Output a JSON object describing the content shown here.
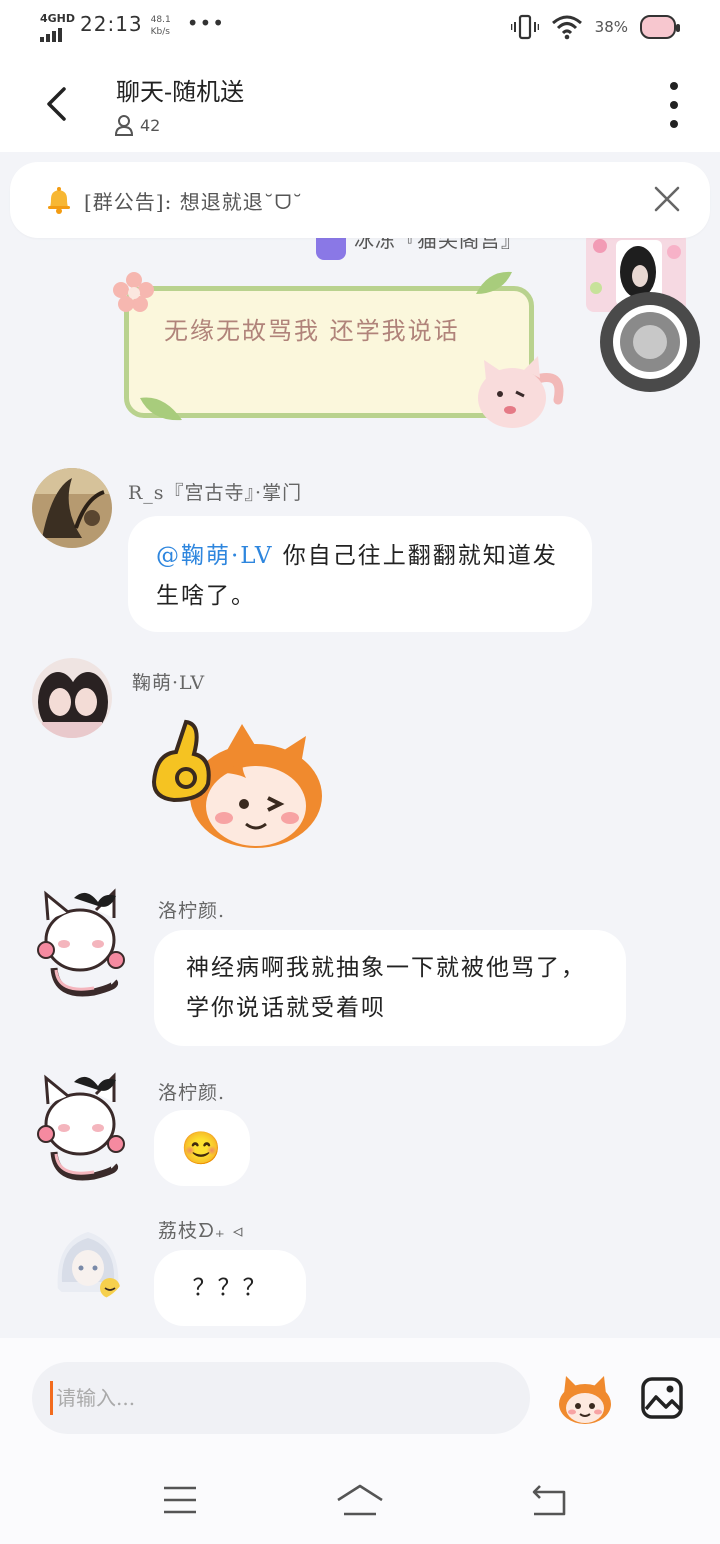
{
  "status_bar": {
    "network": "4GHD",
    "time": "22:13",
    "speed_value": "48.1",
    "speed_unit": "Kb/s",
    "dots": "•••",
    "battery": "38%"
  },
  "header": {
    "title": "聊天-随机送",
    "member_count": "42"
  },
  "announcement": {
    "text": "[群公告]: 想退就退˘ᗜ˘"
  },
  "partial_message": {
    "text": "冰冻『猫尖阁宫』"
  },
  "decorated_message": {
    "text": "无缘无故骂我 还学我说话"
  },
  "messages": [
    {
      "name": "R_s『宫古寺』·掌门",
      "mention": "@鞠萌·LV",
      "text": " 你自己往上翻翻就知道发生啥了。"
    },
    {
      "name": "鞠萌·LV"
    },
    {
      "name": "洛柠颜.",
      "text": "神经病啊我就抽象一下就被他骂了，学你说话就受着呗"
    },
    {
      "name": "洛柠颜.",
      "emoji": "😊"
    },
    {
      "name": "荔枝ᗤ₊ ◃",
      "text": "？？？"
    }
  ],
  "input": {
    "placeholder": "请输入..."
  },
  "colors": {
    "mention": "#2e86de",
    "accent_caret": "#f26b1d",
    "background": "#f3f4f8"
  },
  "icons": {
    "back": "chevron-left-icon",
    "more": "more-vertical-icon",
    "members": "person-icon",
    "bell": "bell-icon",
    "close": "close-icon",
    "image": "image-icon"
  }
}
